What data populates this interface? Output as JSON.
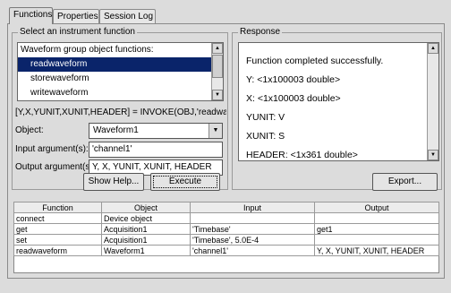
{
  "tabs": [
    "Functions",
    "Properties",
    "Session Log"
  ],
  "instrument": {
    "legend": "Select an instrument function",
    "list_items": [
      "Waveform group object functions:",
      "readwaveform",
      "storewaveform",
      "writewaveform"
    ],
    "syntax": "[Y,X,YUNIT,XUNIT,HEADER] = INVOKE(OBJ,'readwavefor",
    "object_label": "Object:",
    "object_value": "Waveform1",
    "input_label": "Input argument(s):",
    "input_value": "'channel1'",
    "output_label": "Output argument(s):",
    "output_value": "Y, X, YUNIT, XUNIT, HEADER",
    "show_help_label": "Show Help...",
    "execute_label": "Execute"
  },
  "response": {
    "legend": "Response",
    "lines": [
      "Function completed successfully.",
      "Y: <1x100003 double>",
      "X: <1x100003 double>",
      "YUNIT: V",
      "XUNIT: S",
      "HEADER: <1x361 double>"
    ],
    "export_label": "Export..."
  },
  "table": {
    "headers": [
      "Function",
      "Object",
      "Input",
      "Output"
    ],
    "rows": [
      [
        "connect",
        "Device object",
        "",
        ""
      ],
      [
        "get",
        "Acquisition1",
        "'Timebase'",
        "get1"
      ],
      [
        "set",
        "Acquisition1",
        "'Timebase', 5.0E-4",
        ""
      ],
      [
        "readwaveform",
        "Waveform1",
        "'channel1'",
        "Y, X, YUNIT, XUNIT, HEADER"
      ]
    ]
  },
  "icons": [
    "scroll-up-icon",
    "scroll-down-icon",
    "dropdown-arrow-icon"
  ]
}
